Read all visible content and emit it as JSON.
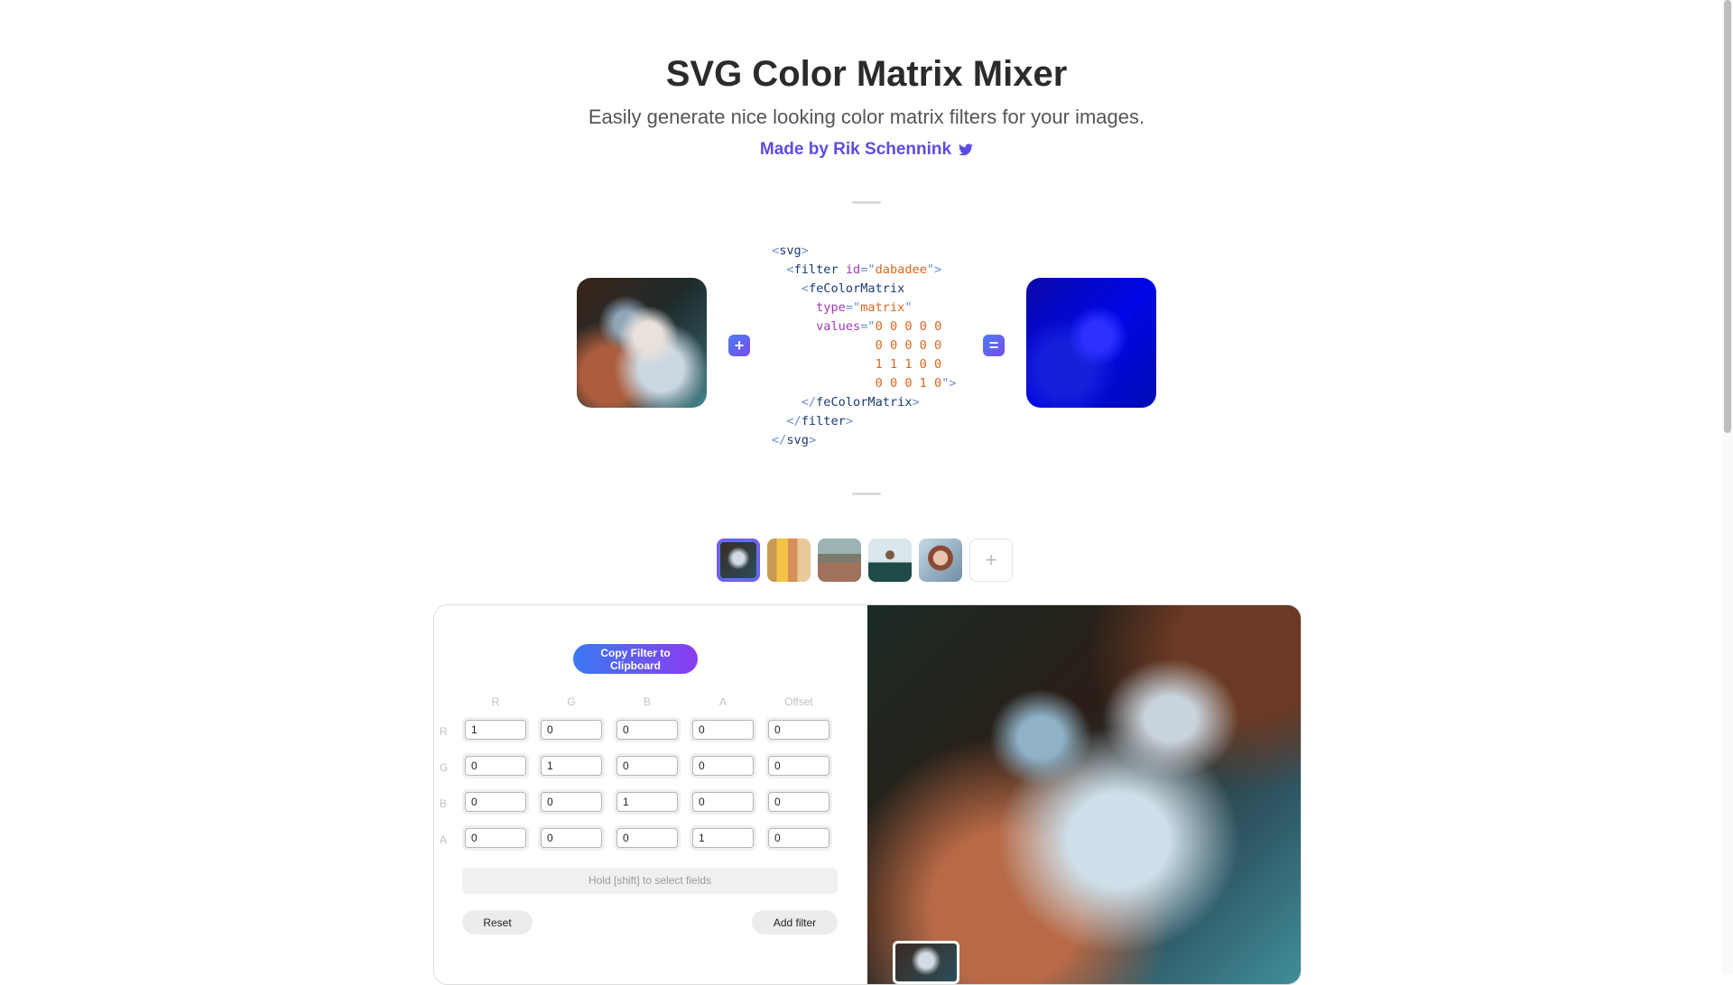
{
  "header": {
    "title": "SVG Color Matrix Mixer",
    "subtitle": "Easily generate nice looking color matrix filters for your images.",
    "author": "Made by Rik Schennink"
  },
  "code": {
    "svg_open": "svg",
    "filter_tag": "filter",
    "id_attr": "id",
    "id_value": "dabadee",
    "matrix_tag": "feColorMatrix",
    "type_attr": "type",
    "type_value": "matrix",
    "values_attr": "values",
    "values_rows": [
      "0 0 0 0 0",
      "0 0 0 0 0",
      "1 1 1 0 0",
      "0 0 0 1 0"
    ]
  },
  "operators": {
    "plus": "+",
    "equals": "="
  },
  "thumbnails": {
    "items": [
      "cat",
      "yellow-buildings",
      "desert-road",
      "man-in-green",
      "woman-portrait"
    ],
    "add_label": "+"
  },
  "editor": {
    "copy_button": "Copy Filter to Clipboard",
    "columns": [
      "R",
      "G",
      "B",
      "A",
      "Offset"
    ],
    "rows": [
      {
        "label": "R",
        "values": [
          "1",
          "0",
          "0",
          "0",
          "0"
        ]
      },
      {
        "label": "G",
        "values": [
          "0",
          "1",
          "0",
          "0",
          "0"
        ]
      },
      {
        "label": "B",
        "values": [
          "0",
          "0",
          "1",
          "0",
          "0"
        ]
      },
      {
        "label": "A",
        "values": [
          "0",
          "0",
          "0",
          "1",
          "0"
        ]
      }
    ],
    "hint": "Hold [shift] to select fields",
    "reset_button": "Reset",
    "add_button": "Add filter"
  },
  "colors": {
    "accent": "#5b4ee0",
    "gradient_start": "#3a7af2",
    "gradient_end": "#8a3cf0"
  }
}
